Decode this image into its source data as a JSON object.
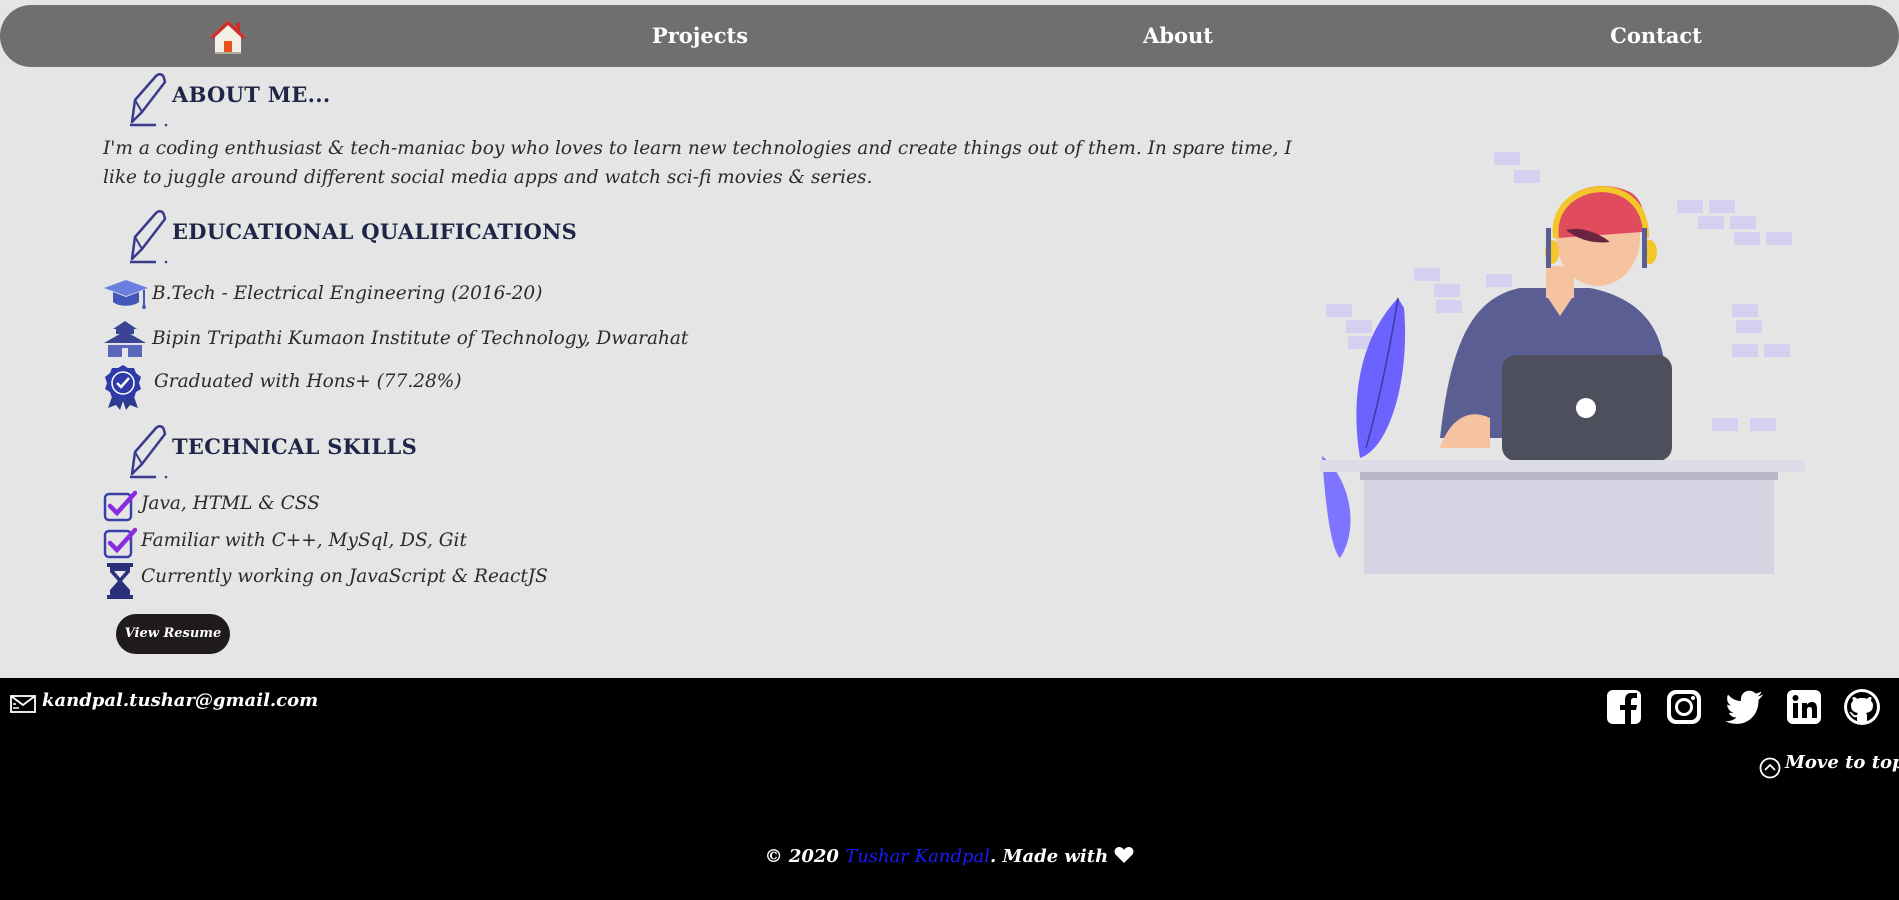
{
  "nav": {
    "home_icon": "home-icon",
    "items": [
      {
        "label": "Projects"
      },
      {
        "label": "About"
      },
      {
        "label": "Contact"
      }
    ]
  },
  "about": {
    "title": "ABOUT ME...",
    "text": "I'm a coding enthusiast & tech-maniac boy who loves to learn new technologies and create things out of them. In spare time, I like to juggle around different social media apps and watch sci-fi movies & series."
  },
  "education": {
    "title": "EDUCATIONAL QUALIFICATIONS",
    "items": [
      {
        "icon": "graduation-cap-icon",
        "text": "B.Tech - Electrical Engineering (2016-20)"
      },
      {
        "icon": "institute-icon",
        "text": "Bipin Tripathi Kumaon Institute of Technology, Dwarahat"
      },
      {
        "icon": "badge-icon",
        "text": "Graduated with Hons+ (77.28%)"
      }
    ]
  },
  "skills": {
    "title": "TECHNICAL SKILLS",
    "items": [
      {
        "icon": "checkbox-icon",
        "text": "Java, HTML & CSS"
      },
      {
        "icon": "checkbox-icon",
        "text": "Familiar with C++, MySql, DS, Git"
      },
      {
        "icon": "hourglass-icon",
        "text": "Currently working on JavaScript & ReactJS"
      }
    ]
  },
  "resume_button": "View Resume",
  "footer": {
    "email": "kandpal.tushar@gmail.com",
    "social": [
      "facebook-icon",
      "instagram-icon",
      "twitter-icon",
      "linkedin-icon",
      "github-icon"
    ],
    "move_to_top": "Move to top",
    "copyright_prefix": "© 2020 ",
    "author": "Tushar Kandpal",
    "copyright_suffix": ". Made with "
  },
  "colors": {
    "nav_bg": "#6f6f6f",
    "page_bg": "#e5e5e5",
    "footer_bg": "#000000",
    "accent_purple": "#6c63ff",
    "author_link": "#1a1aff"
  }
}
